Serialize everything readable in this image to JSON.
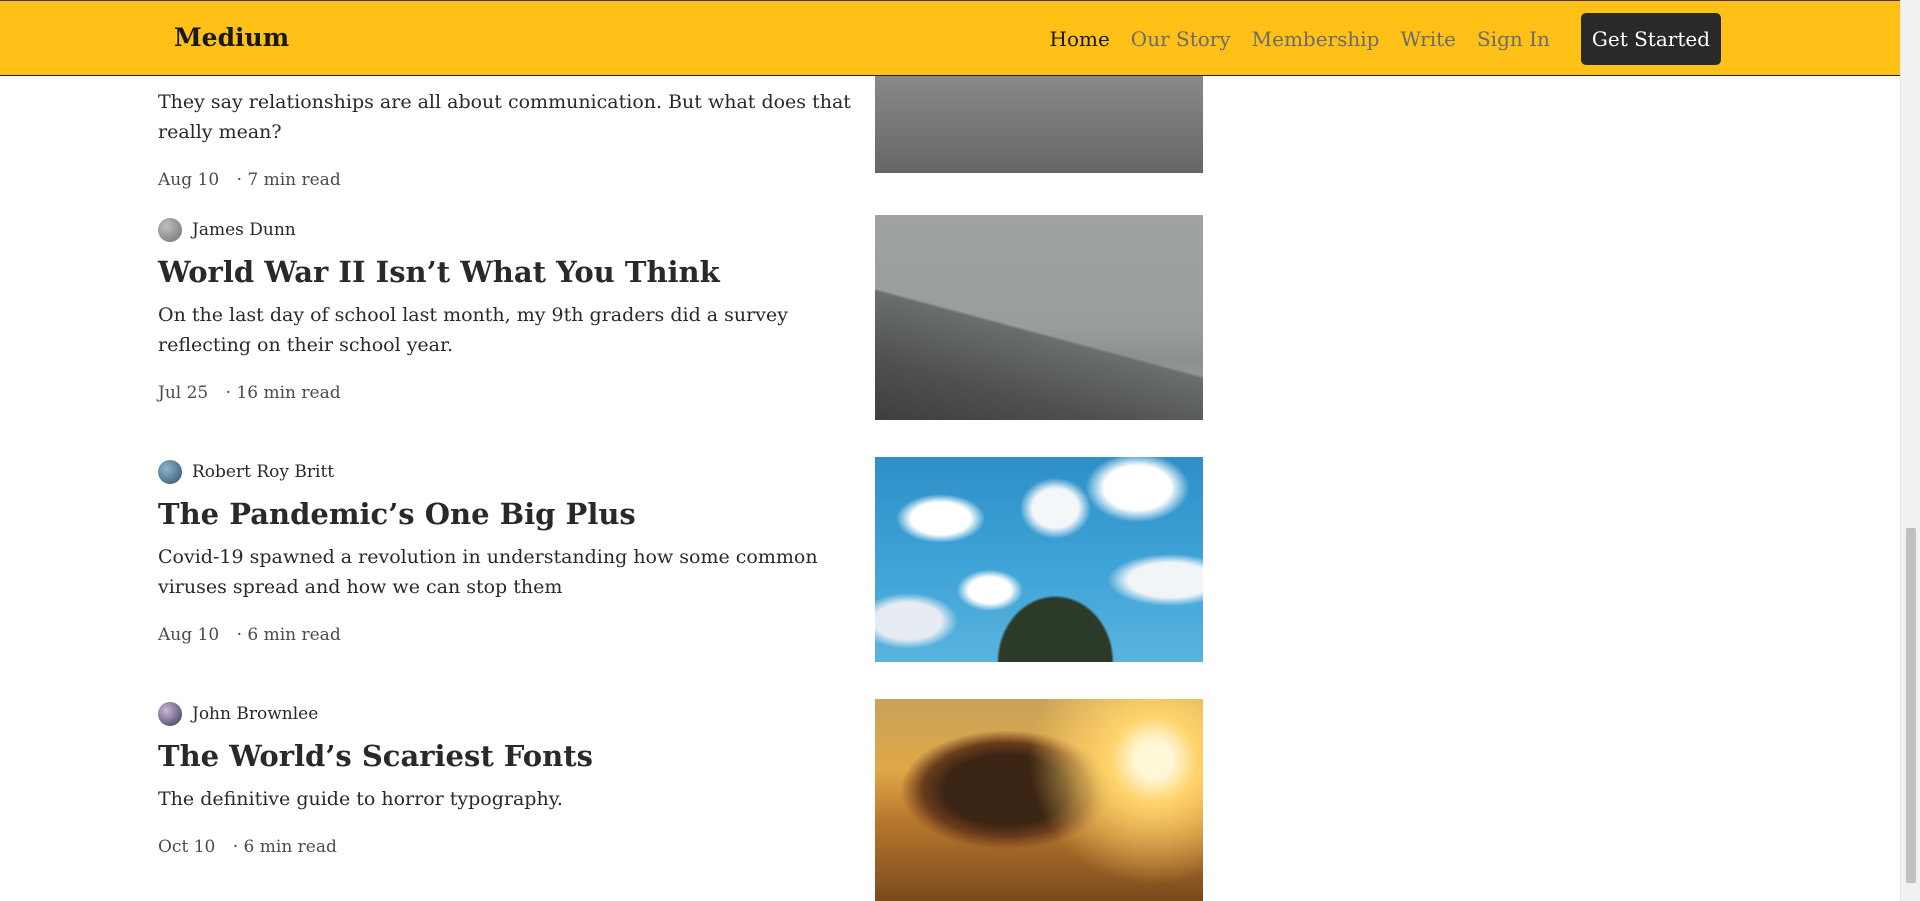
{
  "header": {
    "logo": "Medium",
    "nav": [
      "Home",
      "Our Story",
      "Membership",
      "Write",
      "Sign In"
    ],
    "cta": "Get Started"
  },
  "articles": [
    {
      "author": "",
      "title": "",
      "subtitle": "They say relationships are all about communication. But what does that really mean?",
      "date": "Aug 10",
      "read_time": "· 7 min read"
    },
    {
      "author": "James Dunn",
      "title": "World War II Isn’t What You Think",
      "subtitle": "On the last day of school last month, my 9th graders did a survey reflecting on their school year.",
      "date": "Jul 25",
      "read_time": "· 16 min read"
    },
    {
      "author": "Robert Roy Britt",
      "title": "The Pandemic’s One Big Plus",
      "subtitle": "Covid-19 spawned a revolution in understanding how some common viruses spread and how we can stop them",
      "date": "Aug 10",
      "read_time": "· 6 min read"
    },
    {
      "author": "John Brownlee",
      "title": "The World’s Scariest Fonts",
      "subtitle": "The definitive guide to horror typography.",
      "date": "Oct 10",
      "read_time": "· 6 min read"
    }
  ]
}
